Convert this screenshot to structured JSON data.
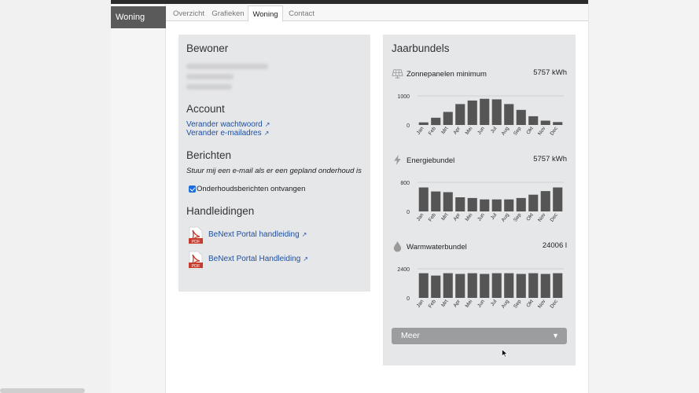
{
  "sidebar": {
    "active_item": "Woning"
  },
  "tabs": [
    {
      "label": "Overzicht"
    },
    {
      "label": "Grafieken"
    },
    {
      "label": "Woning"
    },
    {
      "label": "Contact"
    }
  ],
  "bewoner": {
    "heading": "Bewoner"
  },
  "account": {
    "heading": "Account",
    "change_password": "Verander wachtwoord",
    "change_email": "Verander e-mailadres"
  },
  "berichten": {
    "heading": "Berichten",
    "description": "Stuur mij een e-mail als er een gepland onderhoud is",
    "checkbox_label": "Onderhoudsberichten ontvangen",
    "checkbox_checked": true
  },
  "handleidingen": {
    "heading": "Handleidingen",
    "pdf_badge": "PDF",
    "items": [
      {
        "label": "BeNext Portal handleiding"
      },
      {
        "label": "BeNext Portal Handleiding"
      }
    ]
  },
  "jaarbundels": {
    "heading": "Jaarbundels",
    "more_button": "Meer",
    "accent_color": "#555555"
  },
  "chart_data": [
    {
      "type": "bar",
      "title": "Zonnepanelen minimum",
      "total": "5757 kWh",
      "icon": "solar-panel-icon",
      "categories": [
        "Jan",
        "Feb",
        "Mrt",
        "Apr",
        "Mei",
        "Jun",
        "Jul",
        "Aug",
        "Sep",
        "Okt",
        "Nov",
        "Dec"
      ],
      "values": [
        90,
        250,
        450,
        720,
        840,
        900,
        880,
        720,
        520,
        300,
        150,
        100
      ],
      "yticks": [
        "1000",
        "0"
      ],
      "ylim": [
        0,
        1000
      ]
    },
    {
      "type": "bar",
      "title": "Energiebundel",
      "total": "5757 kWh",
      "icon": "lightning-icon",
      "categories": [
        "Jan",
        "Feb",
        "Mrt",
        "Apr",
        "Mei",
        "Jun",
        "Jul",
        "Aug",
        "Sep",
        "Okt",
        "Nov",
        "Dec"
      ],
      "values": [
        660,
        550,
        530,
        390,
        370,
        330,
        330,
        330,
        370,
        460,
        560,
        660
      ],
      "yticks": [
        "800",
        "0"
      ],
      "ylim": [
        0,
        800
      ]
    },
    {
      "type": "bar",
      "title": "Warmwaterbundel",
      "total": "24006 l",
      "icon": "water-drop-icon",
      "categories": [
        "Jan",
        "Feb",
        "Mrt",
        "Apr",
        "Mei",
        "Jun",
        "Jul",
        "Aug",
        "Sep",
        "Okt",
        "Nov",
        "Dec"
      ],
      "values": [
        2040,
        1840,
        2040,
        1980,
        2040,
        1980,
        2040,
        2040,
        1980,
        2040,
        1980,
        2040
      ],
      "yticks": [
        "2400",
        "0"
      ],
      "ylim": [
        0,
        2400
      ]
    }
  ]
}
